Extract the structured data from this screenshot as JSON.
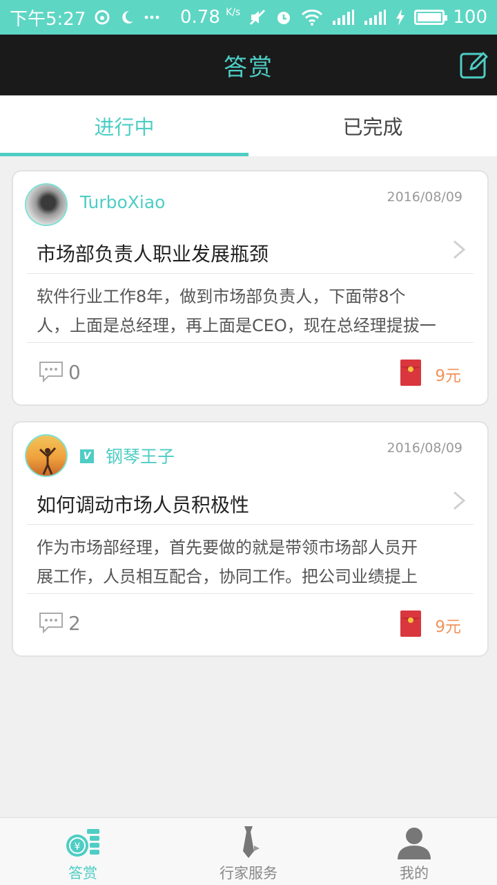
{
  "status_bar": {
    "time": "下午5:27",
    "speed": "0.78",
    "speed_unit": "K/s",
    "battery": "100"
  },
  "header": {
    "title": "答赏"
  },
  "tabs": [
    {
      "label": "进行中",
      "active": true
    },
    {
      "label": "已完成",
      "active": false
    }
  ],
  "cards": [
    {
      "user": "TurboXiao",
      "verified": false,
      "date": "2016/08/09",
      "question": "市场部负责人职业发展瓶颈",
      "body_line1": "软件行业工作8年，做到市场部负责人，下面带8个",
      "body_line2": "人，上面是总经理，再上面是CEO，现在总经理提拔一",
      "comments": "0",
      "reward": "9元"
    },
    {
      "user": "钢琴王子",
      "verified": true,
      "verified_mark": "V",
      "date": "2016/08/09",
      "question": "如何调动市场人员积极性",
      "body_line1": "作为市场部经理，首先要做的就是带领市场部人员开",
      "body_line2": "展工作，人员相互配合，协同工作。把公司业绩提上",
      "comments": "2",
      "reward": "9元"
    }
  ],
  "bottom_nav": [
    {
      "label": "答赏",
      "icon": "coin-stack-icon",
      "active": true
    },
    {
      "label": "行家服务",
      "icon": "tie-icon",
      "active": false
    },
    {
      "label": "我的",
      "icon": "person-icon",
      "active": false
    }
  ],
  "colors": {
    "accent": "#4ecdc4",
    "status_bar": "#5ed6c4",
    "header_bg": "#1a1a1a",
    "reward": "#f0935a",
    "packet": "#d9363e"
  }
}
